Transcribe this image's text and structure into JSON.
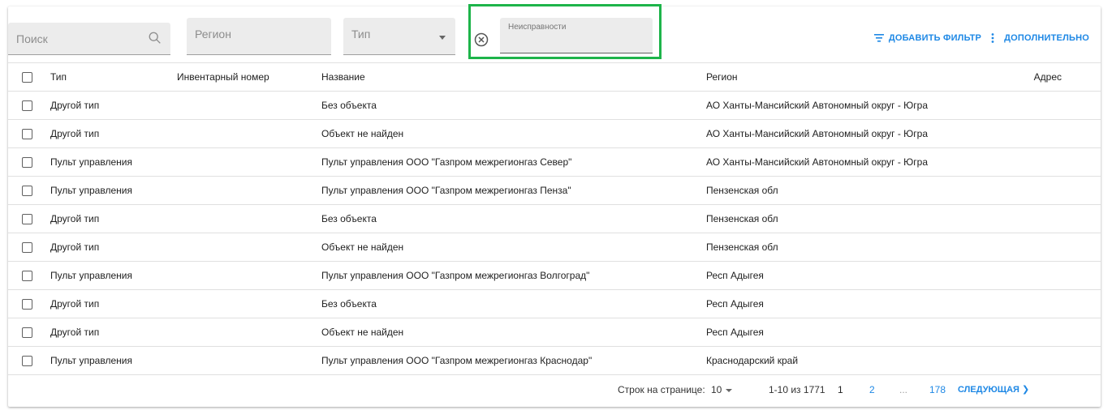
{
  "filters": {
    "search_placeholder": "Поиск",
    "region_placeholder": "Регион",
    "type_placeholder": "Тип",
    "faults_label": "Неисправности",
    "faults_value": ""
  },
  "actions": {
    "add_filter": "ДОБАВИТЬ ФИЛЬТР",
    "more": "ДОПОЛНИТЕЛЬНО"
  },
  "table": {
    "headers": {
      "type": "Тип",
      "inventory": "Инвентарный номер",
      "name": "Название",
      "region": "Регион",
      "address": "Адрес"
    },
    "rows": [
      {
        "type": "Другой тип",
        "inventory": "",
        "name": "Без объекта",
        "region": "АО Ханты-Мансийский Автономный округ - Югра",
        "address": ""
      },
      {
        "type": "Другой тип",
        "inventory": "",
        "name": "Объект не найден",
        "region": "АО Ханты-Мансийский Автономный округ - Югра",
        "address": ""
      },
      {
        "type": "Пульт управления",
        "inventory": "",
        "name": "Пульт управления ООО \"Газпром межрегионгаз Север\"",
        "region": "АО Ханты-Мансийский Автономный округ - Югра",
        "address": ""
      },
      {
        "type": "Пульт управления",
        "inventory": "",
        "name": "Пульт управления ООО \"Газпром межрегионгаз Пенза\"",
        "region": "Пензенская обл",
        "address": ""
      },
      {
        "type": "Другой тип",
        "inventory": "",
        "name": "Без объекта",
        "region": "Пензенская обл",
        "address": ""
      },
      {
        "type": "Другой тип",
        "inventory": "",
        "name": "Объект не найден",
        "region": "Пензенская обл",
        "address": ""
      },
      {
        "type": "Пульт управления",
        "inventory": "",
        "name": "Пульт управления ООО \"Газпром межрегионгаз Волгоград\"",
        "region": "Респ Адыгея",
        "address": ""
      },
      {
        "type": "Другой тип",
        "inventory": "",
        "name": "Без объекта",
        "region": "Респ Адыгея",
        "address": ""
      },
      {
        "type": "Другой тип",
        "inventory": "",
        "name": "Объект не найден",
        "region": "Респ Адыгея",
        "address": ""
      },
      {
        "type": "Пульт управления",
        "inventory": "",
        "name": "Пульт управления ООО \"Газпром межрегионгаз Краснодар\"",
        "region": "Краснодарский край",
        "address": ""
      }
    ]
  },
  "pagination": {
    "rows_per_page_label": "Строк на странице:",
    "rows_per_page": "10",
    "range": "1-10 из 1771",
    "pages": [
      "1",
      "2",
      "...",
      "178"
    ],
    "next": "СЛЕДУЮЩАЯ ❯"
  },
  "colors": {
    "accent": "#1e88e5",
    "highlight_border": "#1db44a"
  }
}
